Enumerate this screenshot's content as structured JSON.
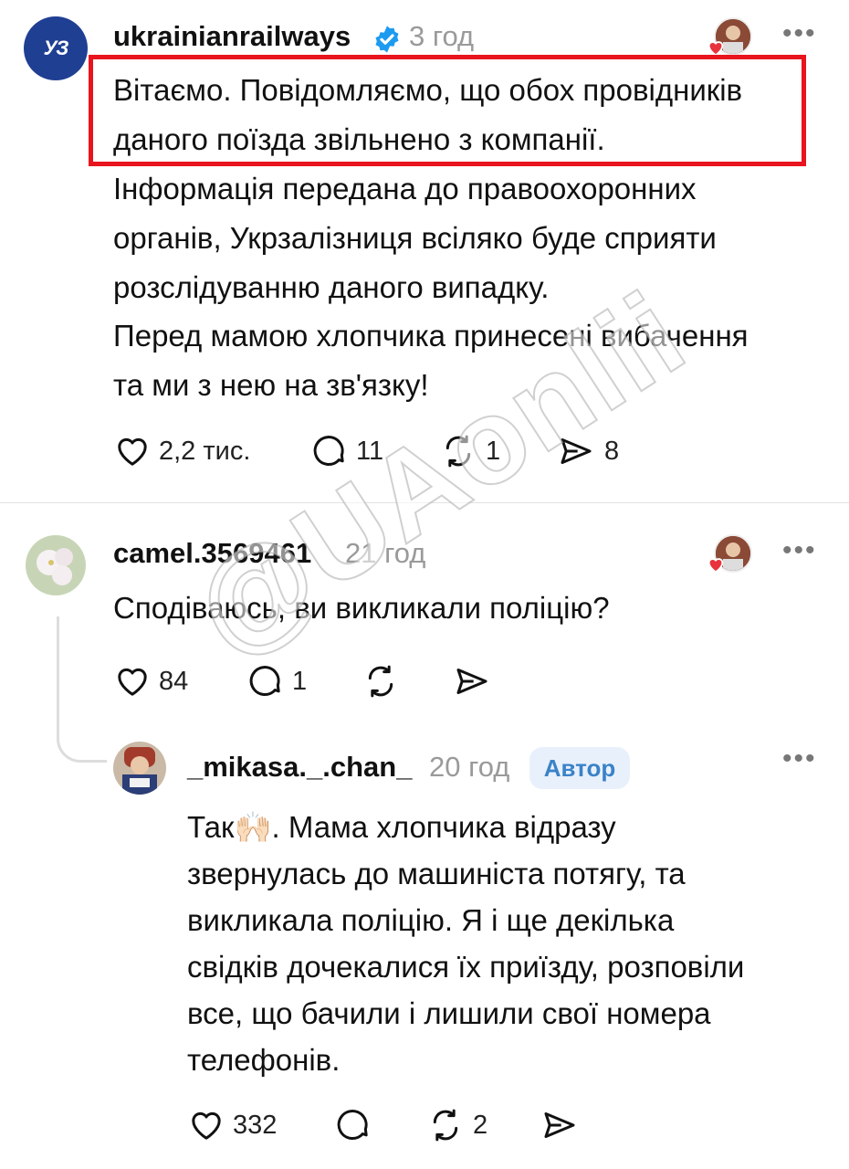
{
  "post": {
    "avatar_text": "УЗ",
    "username": "ukrainianrailways",
    "time": "3 год",
    "more": "•••",
    "lines": [
      "Вітаємо. Повідомляємо, що обох провідників",
      "даного поїзда звільнено з компанії.",
      "Інформація передана до правоохоронних",
      "органів, Укрзалізниця всіляко буде сприяти",
      "розслідуванню даного випадку."
    ],
    "lines2": [
      "Перед мамою хлопчика принесені вибачення",
      "та ми з нею на зв'язку!"
    ],
    "likes": "2,2 тис.",
    "comments": "11",
    "reposts": "1",
    "shares": "8"
  },
  "reply1": {
    "username": "camel.3569461",
    "time": "21 год",
    "more": "•••",
    "text": "Сподіваюсь, ви викликали поліцію?",
    "likes": "84",
    "comments": "1"
  },
  "reply2": {
    "username": "_mikasa._.chan_",
    "time": "20 год",
    "badge": "Автор",
    "more": "•••",
    "lines": [
      "Так🙌🏻. Мама хлопчика відразу",
      "звернулась до машиніста потягу, та",
      "викликала поліцію. Я і ще декілька",
      "свідків дочекалися їх приїзду, розповіли",
      "все, що бачили і лишили свої номера",
      "телефонів."
    ],
    "likes": "332",
    "reposts": "2"
  },
  "watermark": "@UAonlii",
  "colors": {
    "highlight": "#e8141e",
    "verified": "#1d9bf0",
    "badge_bg": "#e8f1fb",
    "badge_text": "#3b82c8",
    "brand": "#1f3f93"
  }
}
